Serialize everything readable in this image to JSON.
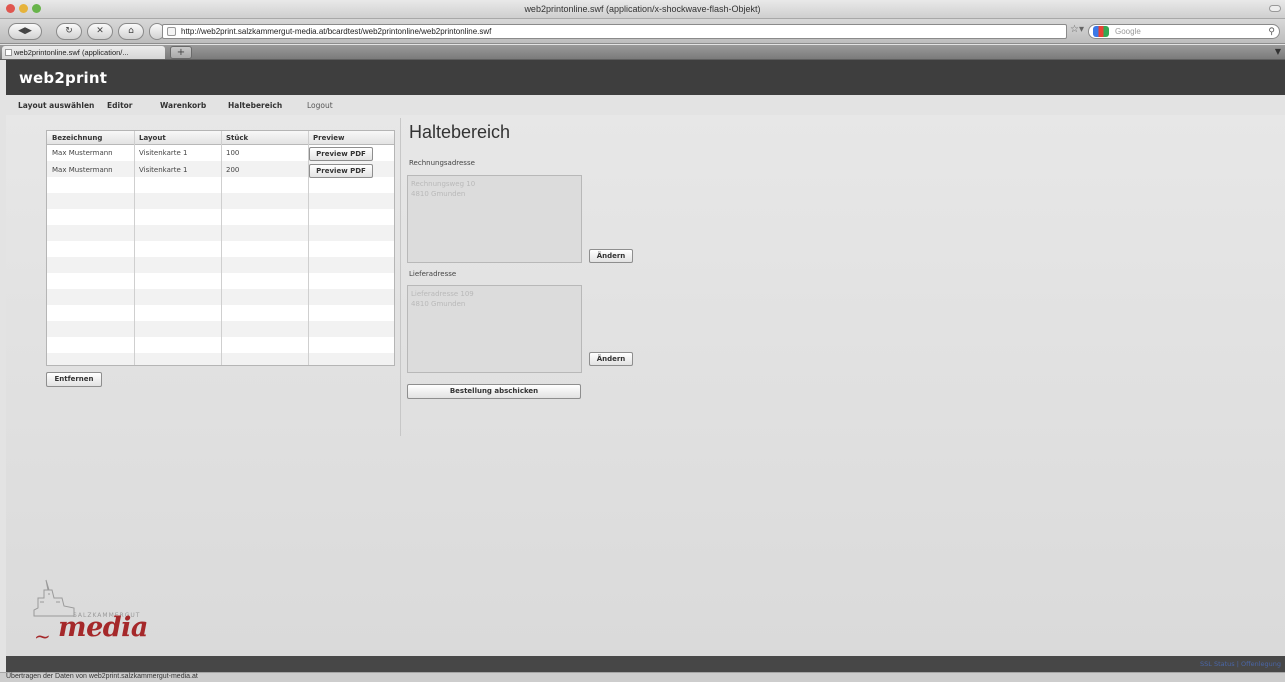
{
  "window": {
    "title": "web2printonline.swf (application/x-shockwave-flash-Objekt)"
  },
  "browser": {
    "url": "http://web2print.salzkammergut-media.at/bcardtest/web2printonline/web2printonline.swf",
    "search_placeholder": "Google",
    "tab_label": "web2printonline.swf (application/...",
    "new_tab": "+",
    "status": "Übertragen der Daten von web2print.salzkammergut-media.at"
  },
  "app": {
    "title": "web2print",
    "menu": [
      "Layout auswählen",
      "Editor",
      "Warenkorb",
      "Haltebereich",
      "Logout"
    ]
  },
  "table": {
    "columns": [
      "Bezeichnung",
      "Layout",
      "Stück",
      "Preview"
    ],
    "rows": [
      {
        "name": "Max Mustermann",
        "layout": "Visitenkarte 1",
        "qty": "100",
        "preview": "Preview PDF"
      },
      {
        "name": "Max Mustermann",
        "layout": "Visitenkarte 1",
        "qty": "200",
        "preview": "Preview PDF"
      }
    ],
    "remove_label": "Entfernen"
  },
  "holding": {
    "title": "Haltebereich",
    "billing_label": "Rechnungsadresse",
    "billing_lines": [
      "Rechnungsweg 10",
      "4810 Gmunden"
    ],
    "delivery_label": "Lieferadresse",
    "delivery_lines": [
      "Lieferadresse 109",
      "4810 Gmunden"
    ],
    "change_label": "Ändern",
    "submit_label": "Bestellung abschicken"
  },
  "logo": {
    "word": "media",
    "small": "SALZKAMMERGUT"
  },
  "footer": {
    "right": "SSL Status | Offenlegung"
  },
  "colors": {
    "header_bg": "#3e3e3e",
    "logo_red": "#a5282a"
  }
}
